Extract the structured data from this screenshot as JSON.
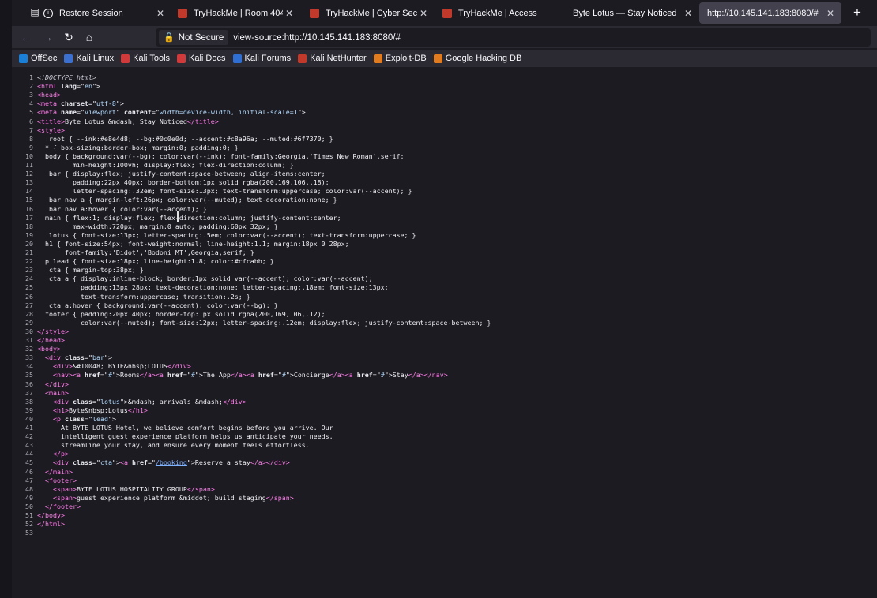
{
  "browser": {
    "tabs": [
      {
        "title": "Restore Session",
        "icon": "info-icon",
        "active": false
      },
      {
        "title": "TryHackMe | Room 404",
        "icon": "tryhackme-icon",
        "active": false
      },
      {
        "title": "TryHackMe | Cyber Securi",
        "icon": "tryhackme-icon",
        "active": false
      },
      {
        "title": "TryHackMe | Access",
        "icon": "tryhackme-icon",
        "active": false
      },
      {
        "title": "Byte Lotus — Stay Noticed",
        "icon": "page-icon",
        "active": false
      },
      {
        "title": "http://10.145.141.183:8080/#",
        "icon": "page-icon",
        "active": true
      }
    ],
    "security_label": "Not Secure",
    "url": "view-source:http://10.145.141.183:8080/#",
    "bookmarks": [
      {
        "label": "OffSec",
        "icon": "offsec-icon",
        "color": "#1a7fd6"
      },
      {
        "label": "Kali Linux",
        "icon": "kali-icon",
        "color": "#3b6fd0"
      },
      {
        "label": "Kali Tools",
        "icon": "kali-tools-icon",
        "color": "#d13a3a"
      },
      {
        "label": "Kali Docs",
        "icon": "kali-docs-icon",
        "color": "#d13a3a"
      },
      {
        "label": "Kali Forums",
        "icon": "kali-forums-icon",
        "color": "#2f6fd3"
      },
      {
        "label": "Kali NetHunter",
        "icon": "nethunter-icon",
        "color": "#c0392b"
      },
      {
        "label": "Exploit-DB",
        "icon": "exploit-db-icon",
        "color": "#e07b1f"
      },
      {
        "label": "Google Hacking DB",
        "icon": "ghdb-icon",
        "color": "#e07b1f"
      }
    ]
  },
  "source_lines": [
    [
      [
        "cm",
        "<!DOCTYPE html>"
      ]
    ],
    [
      [
        "tag",
        "<html "
      ],
      [
        "attr",
        "lang"
      ],
      [
        "txt",
        "=\""
      ],
      [
        "val",
        "en"
      ],
      [
        "txt",
        "\">"
      ]
    ],
    [
      [
        "tag",
        "<head>"
      ]
    ],
    [
      [
        "tag",
        "<meta "
      ],
      [
        "attr",
        "charset"
      ],
      [
        "txt",
        "=\""
      ],
      [
        "val",
        "utf-8"
      ],
      [
        "txt",
        "\">"
      ]
    ],
    [
      [
        "tag",
        "<meta "
      ],
      [
        "attr",
        "name"
      ],
      [
        "txt",
        "=\""
      ],
      [
        "val",
        "viewport"
      ],
      [
        "txt",
        "\" "
      ],
      [
        "attr",
        "content"
      ],
      [
        "txt",
        "=\""
      ],
      [
        "val",
        "width=device-width, initial-scale=1"
      ],
      [
        "txt",
        "\">"
      ]
    ],
    [
      [
        "tag",
        "<title>"
      ],
      [
        "txt",
        "Byte Lotus &mdash; Stay Noticed"
      ],
      [
        "tag",
        "</title>"
      ]
    ],
    [
      [
        "tag",
        "<style>"
      ]
    ],
    [
      [
        "txt",
        "  :root { --ink:#e8e4d8; --bg:#0c0e0d; --accent:#c8a96a; --muted:#6f7370; }"
      ]
    ],
    [
      [
        "txt",
        "  * { box-sizing:border-box; margin:0; padding:0; }"
      ]
    ],
    [
      [
        "txt",
        "  body { background:var(--bg); color:var(--ink); font-family:Georgia,'Times New Roman',serif;"
      ]
    ],
    [
      [
        "txt",
        "         min-height:100vh; display:flex; flex-direction:column; }"
      ]
    ],
    [
      [
        "txt",
        "  .bar { display:flex; justify-content:space-between; align-items:center;"
      ]
    ],
    [
      [
        "txt",
        "         padding:22px 40px; border-bottom:1px solid rgba(200,169,106,.18);"
      ]
    ],
    [
      [
        "txt",
        "         letter-spacing:.32em; font-size:13px; text-transform:uppercase; color:var(--accent); }"
      ]
    ],
    [
      [
        "txt",
        "  .bar nav a { margin-left:26px; color:var(--muted); text-decoration:none; }"
      ]
    ],
    [
      [
        "txt",
        "  .bar nav a:hover { color:var(--accent); }"
      ]
    ],
    [
      [
        "txt",
        "  main { flex:1; display:flex; flex-direction:column; justify-content:center;"
      ]
    ],
    [
      [
        "txt",
        "         max-width:720px; margin:0 auto; padding:60px 32px; }"
      ]
    ],
    [
      [
        "txt",
        "  .lotus { font-size:13px; letter-spacing:.5em; color:var(--accent); text-transform:uppercase; }"
      ]
    ],
    [
      [
        "txt",
        "  h1 { font-size:54px; font-weight:normal; line-height:1.1; margin:18px 0 28px;"
      ]
    ],
    [
      [
        "txt",
        "       font-family:'Didot','Bodoni MT',Georgia,serif; }"
      ]
    ],
    [
      [
        "txt",
        "  p.lead { font-size:18px; line-height:1.8; color:#cfcabb; }"
      ]
    ],
    [
      [
        "txt",
        "  .cta { margin-top:38px; }"
      ]
    ],
    [
      [
        "txt",
        "  .cta a { display:inline-block; border:1px solid var(--accent); color:var(--accent);"
      ]
    ],
    [
      [
        "txt",
        "           padding:13px 28px; text-decoration:none; letter-spacing:.18em; font-size:13px;"
      ]
    ],
    [
      [
        "txt",
        "           text-transform:uppercase; transition:.2s; }"
      ]
    ],
    [
      [
        "txt",
        "  .cta a:hover { background:var(--accent); color:var(--bg); }"
      ]
    ],
    [
      [
        "txt",
        "  footer { padding:20px 40px; border-top:1px solid rgba(200,169,106,.12);"
      ]
    ],
    [
      [
        "txt",
        "           color:var(--muted); font-size:12px; letter-spacing:.12em; display:flex; justify-content:space-between; }"
      ]
    ],
    [
      [
        "tag",
        "</style>"
      ]
    ],
    [
      [
        "tag",
        "</head>"
      ]
    ],
    [
      [
        "tag",
        "<body>"
      ]
    ],
    [
      [
        "txt",
        "  "
      ],
      [
        "tag",
        "<div "
      ],
      [
        "attr",
        "class"
      ],
      [
        "txt",
        "=\""
      ],
      [
        "val",
        "bar"
      ],
      [
        "txt",
        "\">"
      ]
    ],
    [
      [
        "txt",
        "    "
      ],
      [
        "tag",
        "<div>"
      ],
      [
        "txt",
        "&#10048; BYTE&nbsp;LOTUS"
      ],
      [
        "tag",
        "</div>"
      ]
    ],
    [
      [
        "txt",
        "    "
      ],
      [
        "tag",
        "<nav>"
      ],
      [
        "tag",
        "<a "
      ],
      [
        "attr",
        "href"
      ],
      [
        "txt",
        "=\""
      ],
      [
        "val",
        "#"
      ],
      [
        "txt",
        "\">Rooms"
      ],
      [
        "tag",
        "</a>"
      ],
      [
        "tag",
        "<a "
      ],
      [
        "attr",
        "href"
      ],
      [
        "txt",
        "=\""
      ],
      [
        "val",
        "#"
      ],
      [
        "txt",
        "\">The App"
      ],
      [
        "tag",
        "</a>"
      ],
      [
        "tag",
        "<a "
      ],
      [
        "attr",
        "href"
      ],
      [
        "txt",
        "=\""
      ],
      [
        "val",
        "#"
      ],
      [
        "txt",
        "\">Concierge"
      ],
      [
        "tag",
        "</a>"
      ],
      [
        "tag",
        "<a "
      ],
      [
        "attr",
        "href"
      ],
      [
        "txt",
        "=\""
      ],
      [
        "val",
        "#"
      ],
      [
        "txt",
        "\">Stay"
      ],
      [
        "tag",
        "</a>"
      ],
      [
        "tag",
        "</nav>"
      ]
    ],
    [
      [
        "txt",
        "  "
      ],
      [
        "tag",
        "</div>"
      ]
    ],
    [
      [
        "txt",
        "  "
      ],
      [
        "tag",
        "<main>"
      ]
    ],
    [
      [
        "txt",
        "    "
      ],
      [
        "tag",
        "<div "
      ],
      [
        "attr",
        "class"
      ],
      [
        "txt",
        "=\""
      ],
      [
        "val",
        "lotus"
      ],
      [
        "txt",
        "\">&mdash; arrivals &mdash;"
      ],
      [
        "tag",
        "</div>"
      ]
    ],
    [
      [
        "txt",
        "    "
      ],
      [
        "tag",
        "<h1>"
      ],
      [
        "txt",
        "Byte&nbsp;Lotus"
      ],
      [
        "tag",
        "</h1>"
      ]
    ],
    [
      [
        "txt",
        "    "
      ],
      [
        "tag",
        "<p "
      ],
      [
        "attr",
        "class"
      ],
      [
        "txt",
        "=\""
      ],
      [
        "val",
        "lead"
      ],
      [
        "txt",
        "\">"
      ]
    ],
    [
      [
        "txt",
        "      At BYTE LOTUS Hotel, we believe comfort begins before you arrive. Our"
      ]
    ],
    [
      [
        "txt",
        "      intelligent guest experience platform helps us anticipate your needs,"
      ]
    ],
    [
      [
        "txt",
        "      streamline your stay, and ensure every moment feels effortless."
      ]
    ],
    [
      [
        "txt",
        "    "
      ],
      [
        "tag",
        "</p>"
      ]
    ],
    [
      [
        "txt",
        "    "
      ],
      [
        "tag",
        "<div "
      ],
      [
        "attr",
        "class"
      ],
      [
        "txt",
        "=\""
      ],
      [
        "val",
        "cta"
      ],
      [
        "txt",
        "\">"
      ],
      [
        "tag",
        "<a "
      ],
      [
        "attr",
        "href"
      ],
      [
        "txt",
        "=\""
      ],
      [
        "lnk",
        "/booking"
      ],
      [
        "txt",
        "\">Reserve a stay"
      ],
      [
        "tag",
        "</a>"
      ],
      [
        "tag",
        "</div>"
      ]
    ],
    [
      [
        "txt",
        "  "
      ],
      [
        "tag",
        "</main>"
      ]
    ],
    [
      [
        "txt",
        "  "
      ],
      [
        "tag",
        "<footer>"
      ]
    ],
    [
      [
        "txt",
        "    "
      ],
      [
        "tag",
        "<span>"
      ],
      [
        "txt",
        "BYTE LOTUS HOSPITALITY GROUP"
      ],
      [
        "tag",
        "</span>"
      ]
    ],
    [
      [
        "txt",
        "    "
      ],
      [
        "tag",
        "<span>"
      ],
      [
        "txt",
        "guest experience platform &middot; build staging"
      ],
      [
        "tag",
        "</span>"
      ]
    ],
    [
      [
        "txt",
        "  "
      ],
      [
        "tag",
        "</footer>"
      ]
    ],
    [
      [
        "tag",
        "</body>"
      ]
    ],
    [
      [
        "tag",
        "</html>"
      ]
    ],
    []
  ]
}
